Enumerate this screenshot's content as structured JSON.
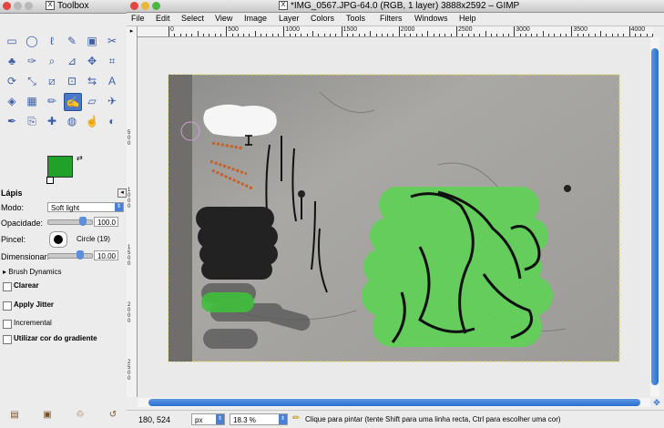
{
  "toolbox": {
    "title": "Toolbox",
    "tools": [
      {
        "name": "rect-select",
        "glyph": "▭"
      },
      {
        "name": "ellipse-select",
        "glyph": "◯"
      },
      {
        "name": "lasso",
        "glyph": "ℓ"
      },
      {
        "name": "fuzzy-select",
        "glyph": "✎"
      },
      {
        "name": "select-by-color",
        "glyph": "▣"
      },
      {
        "name": "scissors",
        "glyph": "✂"
      },
      {
        "name": "paths",
        "glyph": "♣"
      },
      {
        "name": "color-picker",
        "glyph": "✑"
      },
      {
        "name": "zoom",
        "glyph": "⌕"
      },
      {
        "name": "measure",
        "glyph": "⊿"
      },
      {
        "name": "move",
        "glyph": "✥"
      },
      {
        "name": "crop",
        "glyph": "⌗"
      },
      {
        "name": "rotate",
        "glyph": "⟳"
      },
      {
        "name": "scale",
        "glyph": "⤡"
      },
      {
        "name": "shear",
        "glyph": "⧄"
      },
      {
        "name": "perspective",
        "glyph": "⊡"
      },
      {
        "name": "flip",
        "glyph": "⇆"
      },
      {
        "name": "text",
        "glyph": "A"
      },
      {
        "name": "bucket-fill",
        "glyph": "◈"
      },
      {
        "name": "blend",
        "glyph": "▦"
      },
      {
        "name": "pencil",
        "glyph": "✏"
      },
      {
        "name": "paintbrush",
        "glyph": "✍"
      },
      {
        "name": "eraser",
        "glyph": "▱"
      },
      {
        "name": "airbrush",
        "glyph": "✈"
      },
      {
        "name": "ink",
        "glyph": "✒"
      },
      {
        "name": "clone",
        "glyph": "⎘"
      },
      {
        "name": "heal",
        "glyph": "✚"
      },
      {
        "name": "blur",
        "glyph": "◍"
      },
      {
        "name": "smudge",
        "glyph": "☝"
      },
      {
        "name": "dodge-burn",
        "glyph": "◐"
      }
    ],
    "fg_color": "#1fa12a",
    "bg_color": "#ffffff",
    "options": {
      "title": "Lápis",
      "mode_label": "Modo:",
      "mode_value": "Soft light",
      "opacity_label": "Opacidade:",
      "opacity_value": "100.0",
      "brush_label": "Pincel:",
      "brush_value": "Circle (19)",
      "scale_label": "Dimensionar:",
      "scale_value": "10.00",
      "dynamics_label": "Brush Dynamics",
      "checks": [
        "Clarear",
        "Apply Jitter",
        "Incremental",
        "Utilizar cor do gradiente"
      ]
    }
  },
  "image_window": {
    "title": "*IMG_0567.JPG-64.0 (RGB, 1 layer) 3888x2592 – GIMP",
    "menu": [
      "File",
      "Edit",
      "Select",
      "View",
      "Image",
      "Layer",
      "Colors",
      "Tools",
      "Filters",
      "Windows",
      "Help"
    ],
    "ruler_labels": [
      "0",
      "500",
      "1000",
      "1500",
      "2000",
      "2500",
      "3000",
      "3500",
      "4000"
    ],
    "vruler_labels": [
      "5\n0\n0",
      "1\n0\n0\n0",
      "1\n5\n0\n0",
      "2\n0\n0\n0",
      "2\n5\n0\n0"
    ],
    "status": {
      "coords": "180, 524",
      "unit": "px",
      "zoom": "18.3 %",
      "hint": "Clique para pintar (tente Shift para uma linha recta, Ctrl para escolher uma cor)"
    }
  }
}
